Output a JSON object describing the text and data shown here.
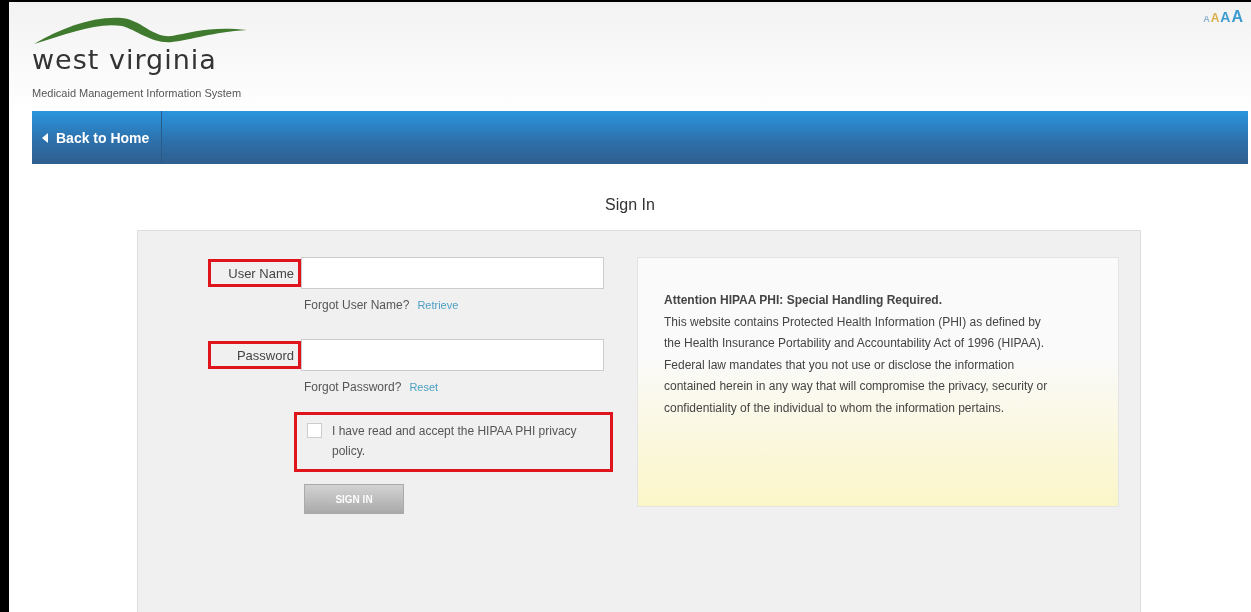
{
  "header": {
    "logo_text": "west virginia",
    "subtitle": "Medicaid Management Information System",
    "font_sizes": [
      {
        "label": "A",
        "selected": false
      },
      {
        "label": "A",
        "selected": true
      },
      {
        "label": "A",
        "selected": false
      },
      {
        "label": "A",
        "selected": false
      }
    ]
  },
  "nav": {
    "back_link": "Back to Home"
  },
  "title": "Sign In",
  "form": {
    "fields": [
      {
        "label": "User Name",
        "help": "Forgot User Name?",
        "link": "Retrieve",
        "highlighted": true
      },
      {
        "label": "Password",
        "help": "Forgot Password?",
        "link": "Reset",
        "highlighted": true
      }
    ],
    "agreement": {
      "text": "I have read and accept the HIPAA PHI privacy policy.",
      "checked": false,
      "highlighted": true
    },
    "submit": {
      "label": "SIGN IN",
      "disabled": true
    }
  },
  "notice": {
    "heading": "Attention HIPAA PHI: Special Handling Required.",
    "body": "This website contains Protected Health Information (PHI) as defined by the Health Insurance Portability and Accountability Act of 1996 (HIPAA). Federal law mandates that you not use or disclose the information contained herein in any way that will compromise the privacy, security or confidentiality of the individual to whom the information pertains."
  }
}
